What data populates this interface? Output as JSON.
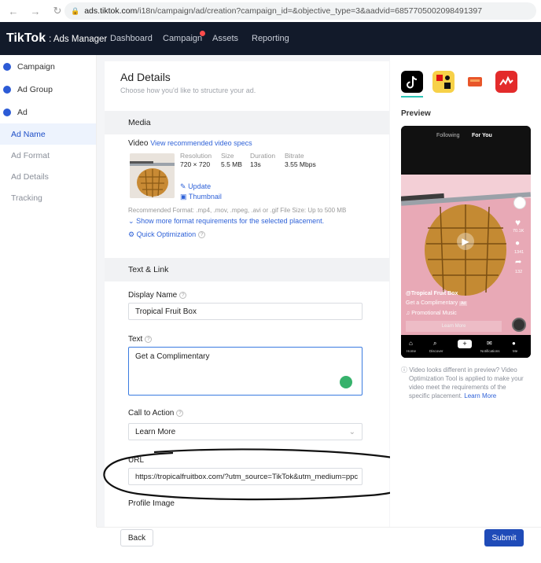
{
  "browser": {
    "url_host": "ads.tiktok.com",
    "url_path": "/i18n/campaign/ad/creation?campaign_id=&objective_type=3&aadvid=6857705002098491397"
  },
  "topnav": {
    "brand": "TikTok",
    "brand_sub": ": Ads Manager",
    "items": [
      "Dashboard",
      "Campaign",
      "Assets",
      "Reporting"
    ]
  },
  "sidebar": {
    "steps": [
      "Campaign",
      "Ad Group",
      "Ad"
    ],
    "subs": [
      "Ad Name",
      "Ad Format",
      "Ad Details",
      "Tracking"
    ]
  },
  "ad_details": {
    "title": "Ad Details",
    "subtitle": "Choose how you'd like to structure your ad."
  },
  "media": {
    "section": "Media",
    "video_label": "Video",
    "video_specs_link": "View recommended video specs",
    "resolution_label": "Resolution",
    "resolution": "720 × 720",
    "size_label": "Size",
    "size": "5.5 MB",
    "duration_label": "Duration",
    "duration": "13s",
    "bitrate_label": "Bitrate",
    "bitrate": "3.55 Mbps",
    "update": "Update",
    "thumbnail": "Thumbnail",
    "format_note": "Recommended Format: .mp4, .mov, .mpeg, .avi or .gif  File Size: Up to 500 MB",
    "more_reqs": "Show more format requirements for the selected placement.",
    "quick_opt": "Quick Optimization"
  },
  "text_link": {
    "section": "Text & Link",
    "display_name_label": "Display Name",
    "display_name": "Tropical Fruit Box",
    "text_label": "Text",
    "text_value": "Get a Complimentary",
    "cta_label": "Call to Action",
    "cta_value": "Learn More",
    "url_label": "URL",
    "url_value": "https://tropicalfruitbox.com/?utm_source=TikTok&utm_medium=ppc",
    "profile_image_label": "Profile Image"
  },
  "footer": {
    "back": "Back",
    "submit": "Submit"
  },
  "preview": {
    "title": "Preview",
    "tab_following": "Following",
    "tab_foryou": "For You",
    "name": "@Tropical Fruit Box",
    "caption": "Get a Complimentary",
    "sponsored": "Ad",
    "music": "Promotional Music",
    "learn_more": "Learn More",
    "like_count": "70.1K",
    "comment_count": "1341",
    "share_count": "132",
    "nav": [
      "Home",
      "Discover",
      "Notifications",
      "Me"
    ],
    "note_a": "Video looks different in preview? Video",
    "note_b": "Optimization Tool is applied to make your",
    "note_c": "video meet the requirements of the",
    "note_d": "specific placement.",
    "note_link": "Learn More"
  }
}
